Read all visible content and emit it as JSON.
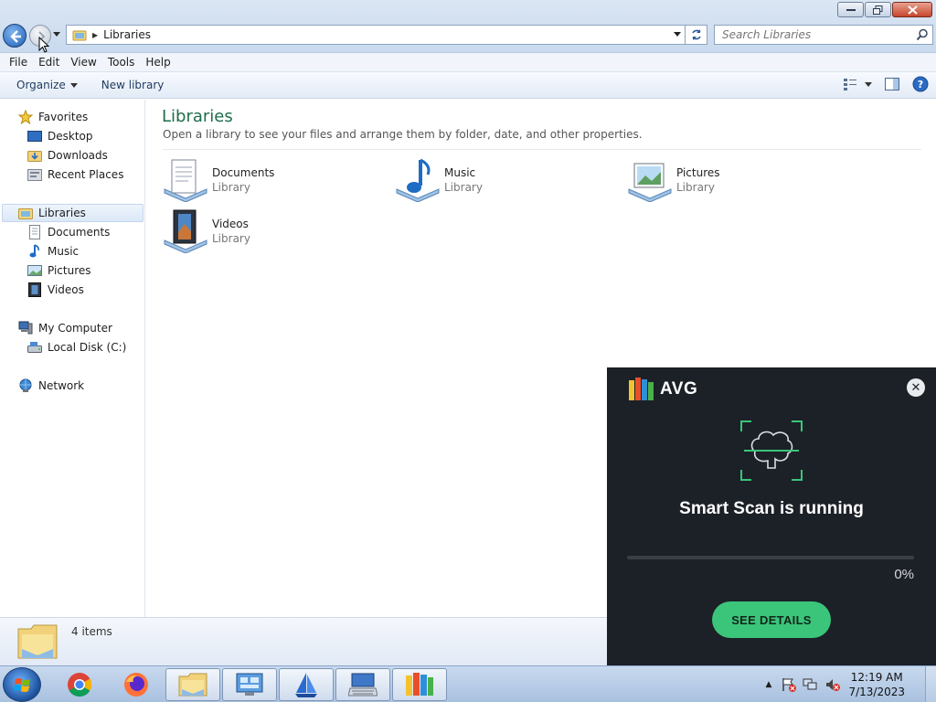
{
  "window": {
    "controls": {
      "minimize": "minimize-icon",
      "maximize": "restore-icon",
      "close": "close-icon"
    }
  },
  "address": {
    "crumb": "Libraries"
  },
  "search": {
    "placeholder": "Search Libraries"
  },
  "menu": [
    "File",
    "Edit",
    "View",
    "Tools",
    "Help"
  ],
  "commands": {
    "organize": "Organize",
    "new_library": "New library"
  },
  "nav": {
    "favorites": {
      "label": "Favorites",
      "items": [
        "Desktop",
        "Downloads",
        "Recent Places"
      ]
    },
    "libraries": {
      "label": "Libraries",
      "items": [
        "Documents",
        "Music",
        "Pictures",
        "Videos"
      ]
    },
    "computer": {
      "label": "My Computer",
      "items": [
        "Local Disk (C:)"
      ]
    },
    "network": {
      "label": "Network"
    }
  },
  "content": {
    "title": "Libraries",
    "description": "Open a library to see your files and arrange them by folder, date, and other properties.",
    "libraries": [
      {
        "name": "Documents",
        "type": "Library"
      },
      {
        "name": "Music",
        "type": "Library"
      },
      {
        "name": "Pictures",
        "type": "Library"
      },
      {
        "name": "Videos",
        "type": "Library"
      }
    ]
  },
  "details": {
    "count": "4 items"
  },
  "avg": {
    "logo": "AVG",
    "title": "Smart Scan is running",
    "progress_percent": 0,
    "progress_label": "0%",
    "button": "SEE DETAILS",
    "accent": "#3bc57a"
  },
  "taskbar": {
    "apps": [
      "chrome-icon",
      "firefox-icon",
      "explorer-icon",
      "control-panel-icon",
      "sailboat-app-icon",
      "remote-keyboard-icon",
      "avg-icon"
    ],
    "clock": {
      "time": "12:19 AM",
      "date": "7/13/2023"
    }
  }
}
